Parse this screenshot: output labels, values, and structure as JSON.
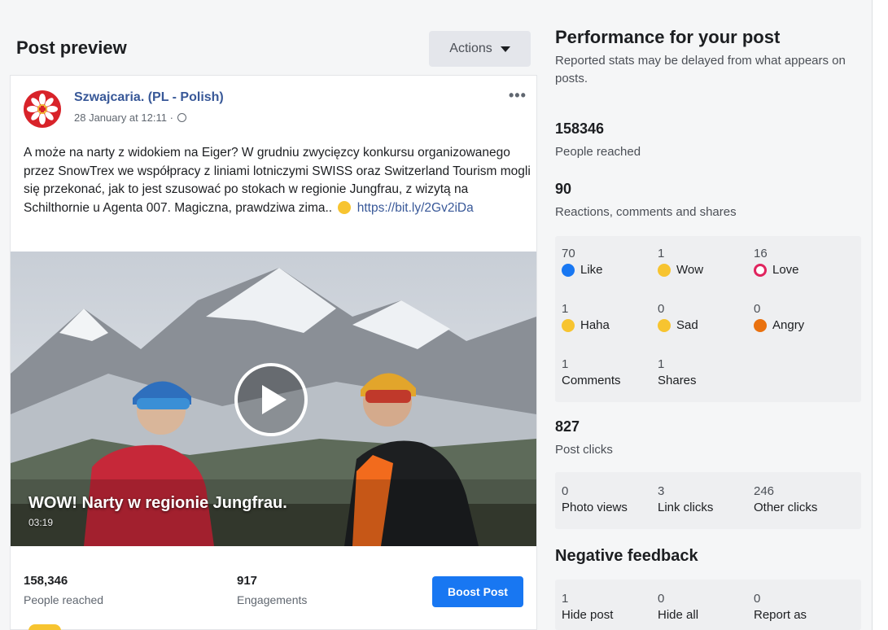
{
  "left": {
    "title": "Post preview",
    "actions_label": "Actions",
    "post": {
      "page_name": "Szwajcaria. (PL - Polish)",
      "date": "28 January at 12:11 ·",
      "text": "A może na narty z widokiem na Eiger? W grudniu zwycięzcy konkursu organizowanego przez SnowTrex we współpracy z liniami lotniczymi SWISS oraz Switzerland Tourism mogli się przekonać, jak to jest szusować po stokach w regionie Jungfrau, z wizytą na Schilthornie u Agenta 007. Magiczna, prawdziwa zima..",
      "link": "https://bit.ly/2Gv2iDa",
      "video_title": "WOW! Narty w regionie Jungfrau.",
      "video_duration": "03:19"
    },
    "stats": {
      "reached_value": "158,346",
      "reached_label": "People reached",
      "engagements_value": "917",
      "engagements_label": "Engagements",
      "boost_label": "Boost Post"
    }
  },
  "right": {
    "title": "Performance for your post",
    "subtitle": "Reported stats may be delayed from what appears on posts.",
    "reached_value": "158346",
    "reached_label": "People reached",
    "reactions_value": "90",
    "reactions_label": "Reactions, comments and shares",
    "reactions": [
      {
        "value": "70",
        "label": "Like",
        "color": "#1877f2"
      },
      {
        "value": "1",
        "label": "Wow",
        "color": "#f7c430"
      },
      {
        "value": "16",
        "label": "Love",
        "color": "#e0245e"
      },
      {
        "value": "1",
        "label": "Haha",
        "color": "#f7c430"
      },
      {
        "value": "0",
        "label": "Sad",
        "color": "#f7c430"
      },
      {
        "value": "0",
        "label": "Angry",
        "color": "#e9710f"
      },
      {
        "value": "1",
        "label": "Comments"
      },
      {
        "value": "1",
        "label": "Shares"
      }
    ],
    "clicks_value": "827",
    "clicks_label": "Post clicks",
    "clicks": [
      {
        "value": "0",
        "label": "Photo views"
      },
      {
        "value": "3",
        "label": "Link clicks"
      },
      {
        "value": "246",
        "label": "Other clicks"
      }
    ],
    "negative_title": "Negative feedback",
    "negative": [
      {
        "value": "1",
        "label": "Hide post"
      },
      {
        "value": "0",
        "label": "Hide all"
      },
      {
        "value": "0",
        "label": "Report as"
      }
    ]
  }
}
